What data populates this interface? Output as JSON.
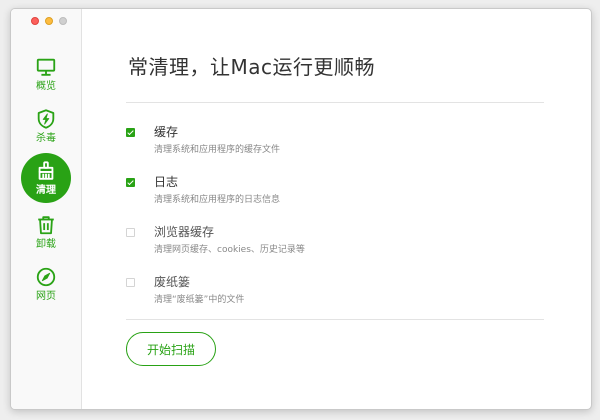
{
  "sidebar": {
    "items": [
      {
        "icon": "monitor-icon",
        "label": "概览"
      },
      {
        "icon": "shield-lightning-icon",
        "label": "杀毒"
      },
      {
        "icon": "brush-icon",
        "label": "清理",
        "active": true
      },
      {
        "icon": "trash-icon",
        "label": "卸载"
      },
      {
        "icon": "compass-icon",
        "label": "网页"
      }
    ]
  },
  "main": {
    "title": "常清理，让Mac运行更顺畅",
    "options": [
      {
        "name": "缓存",
        "description": "清理系统和应用程序的缓存文件",
        "checked": true
      },
      {
        "name": "日志",
        "description": "清理系统和应用程序的日志信息",
        "checked": true
      },
      {
        "name": "浏览器缓存",
        "description": "清理网页缓存、cookies、历史记录等",
        "checked": false
      },
      {
        "name": "废纸篓",
        "description": "清理“废纸篓”中的文件",
        "checked": false
      }
    ],
    "scan_button": "开始扫描"
  },
  "colors": {
    "accent": "#29a215",
    "traffic_close": "#fc605c",
    "traffic_minimize": "#fdbc40"
  }
}
